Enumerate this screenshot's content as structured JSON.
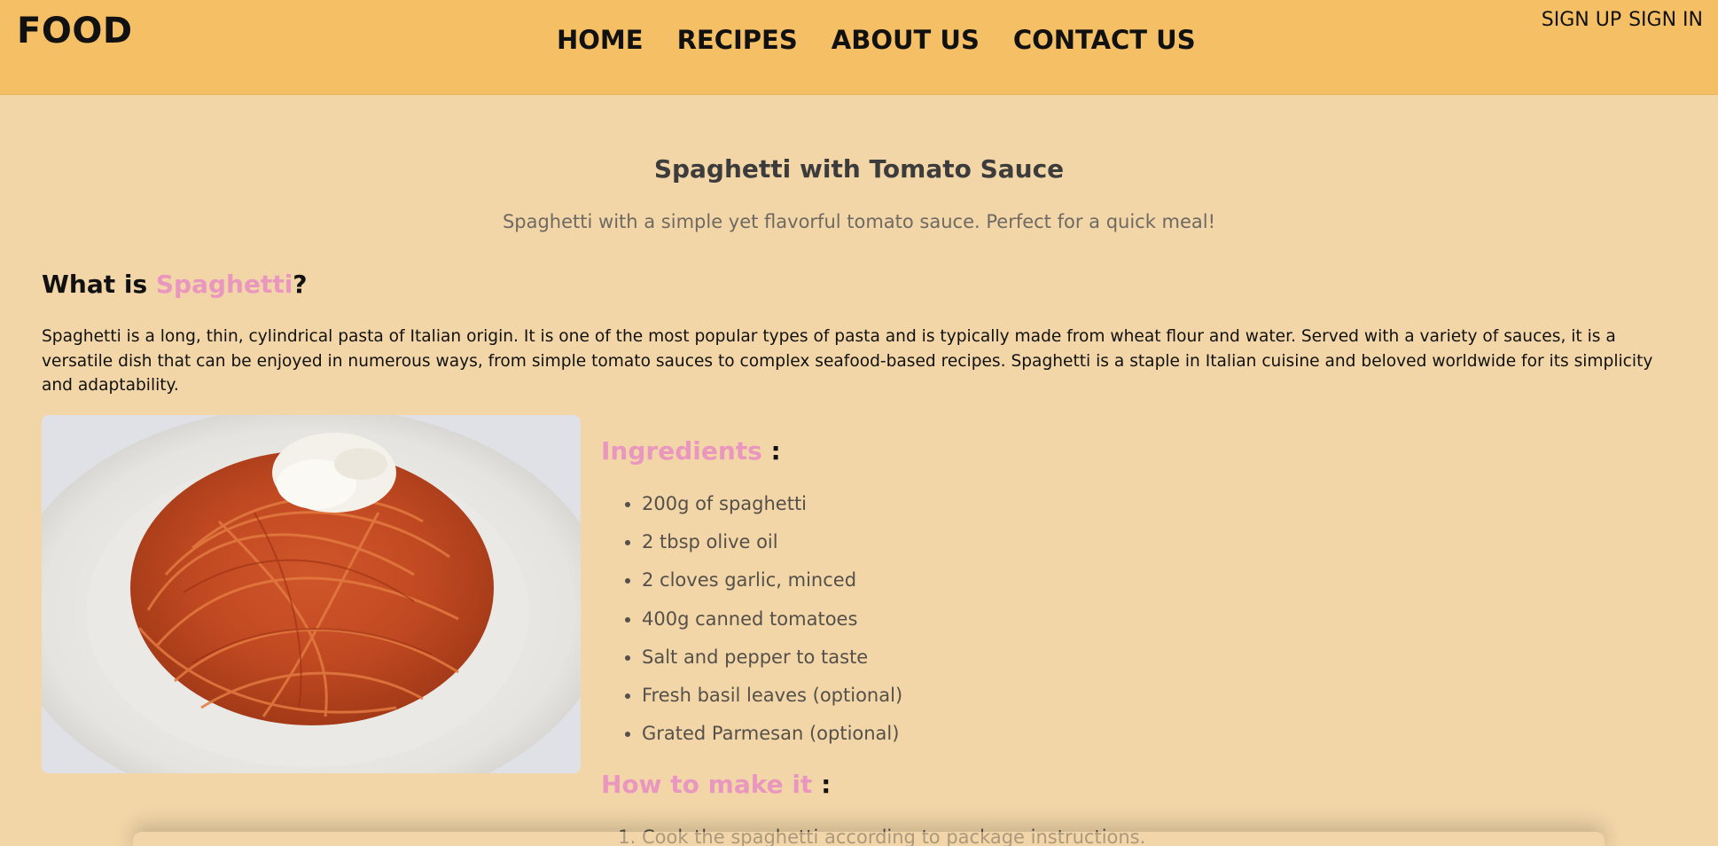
{
  "header": {
    "logo": "FOOD",
    "nav": [
      "HOME",
      "RECIPES",
      "ABOUT US",
      "CONTACT US"
    ],
    "sign_up": "SIGN UP",
    "sign_in": "SIGN IN"
  },
  "recipe": {
    "title": "Spaghetti with Tomato Sauce",
    "description": "Spaghetti with a simple yet flavorful tomato sauce. Perfect for a quick meal!",
    "what_is_prefix": "What is ",
    "what_is_name": "Spaghetti",
    "what_is_suffix": "?",
    "about": "Spaghetti is a long, thin, cylindrical pasta of Italian origin. It is one of the most popular types of pasta and is typically made from wheat flour and water. Served with a variety of sauces, it is a versatile dish that can be enjoyed in numerous ways, from simple tomato sauces to complex seafood-based recipes. Spaghetti is a staple in Italian cuisine and beloved worldwide for its simplicity and adaptability.",
    "ingredients_label": "Ingredients",
    "ingredients_colon": " :",
    "ingredients": [
      "200g of spaghetti",
      "2 tbsp olive oil",
      "2 cloves garlic, minced",
      "400g canned tomatoes",
      "Salt and pepper to taste",
      "Fresh basil leaves (optional)",
      "Grated Parmesan (optional)"
    ],
    "method_label": "How to make it",
    "method_colon": " :",
    "steps": [
      "Cook the spaghetti according to package instructions."
    ]
  },
  "colors": {
    "header_bg": "#f5c065",
    "page_bg": "#f2d6a8",
    "accent_pink": "#e997bf"
  }
}
